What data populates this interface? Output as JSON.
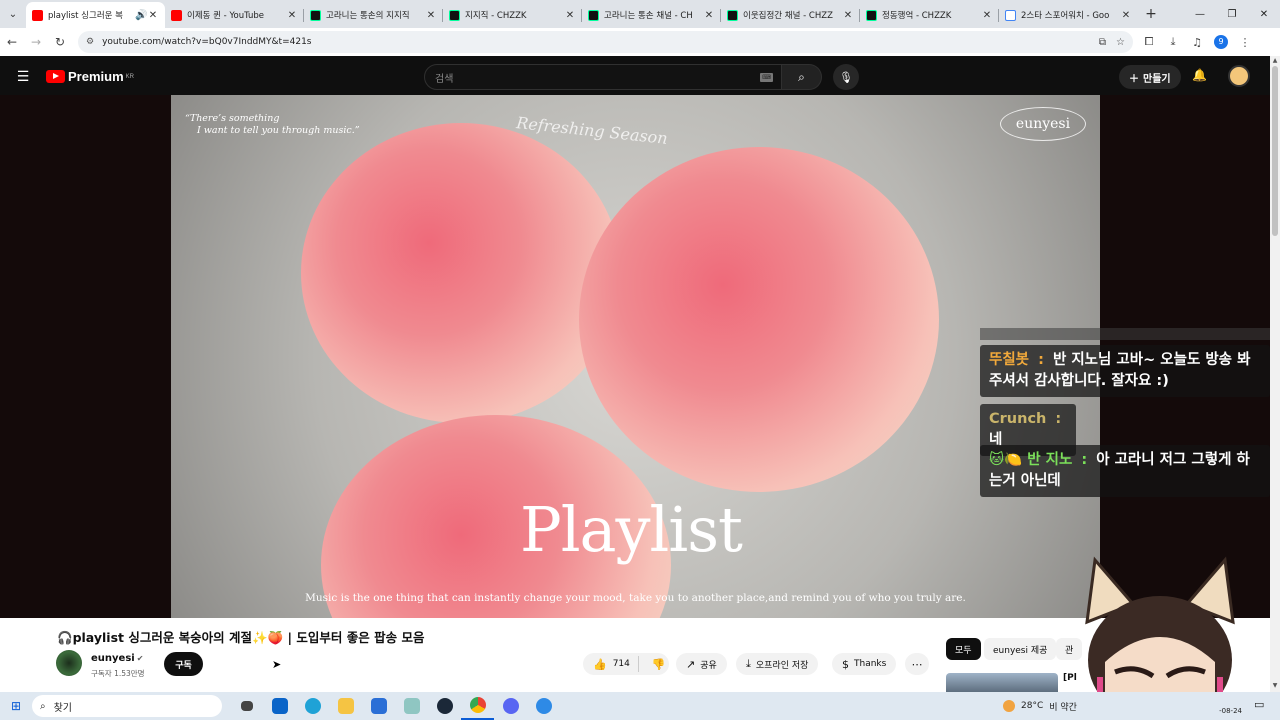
{
  "browser": {
    "tabs": [
      {
        "title": "playlist 싱그러운 복",
        "favicon": "youtube",
        "active": true
      },
      {
        "title": "이제동 퀸 - YouTube",
        "favicon": "youtube"
      },
      {
        "title": "고라니는 통손의 지지직",
        "favicon": "chzzk"
      },
      {
        "title": "지지직 - CHZZK",
        "favicon": "chzzk"
      },
      {
        "title": "고라니는 통손 채널 - CH",
        "favicon": "chzzk"
      },
      {
        "title": "이웃집정간 채널 - CHZZ",
        "favicon": "chzzk"
      },
      {
        "title": "정동행억 - CHZZK",
        "favicon": "chzzk"
      },
      {
        "title": "2스타 스포어워치 - Goo",
        "favicon": "google"
      }
    ],
    "url": "youtube.com/watch?v=bQ0v7InddMY&t=421s",
    "profile_initial": "9"
  },
  "youtube": {
    "logo_text": "Premium",
    "logo_region": "KR",
    "search_placeholder": "검색",
    "create_label": "만들기"
  },
  "video_frame": {
    "quote_line1": "“There’s something",
    "quote_line2": "I want to tell you through music.”",
    "script_text": "Refreshing Season",
    "brand": "eunyesi",
    "title": "Playlist",
    "caption": "Music is the one thing that can instantly change your mood, take you to another place,and remind you of who you truly are."
  },
  "chat": {
    "messages": [
      {
        "nick": "뚜칠봇",
        "sep": " : ",
        "text": "반 지노님 고바~ 오늘도 방송 봐주셔서 감사합니다. 잘자요 :)",
        "nick_color": "#f2a93b"
      },
      {
        "nick": "Crunch",
        "sep": " : ",
        "text": "네",
        "nick_color": "#c9b46a"
      },
      {
        "nick": "🐱🍋 반 지노",
        "sep": " : ",
        "text": "아 고라니 저그 그렇게 하는거 아닌데",
        "nick_color": "#7be05a"
      }
    ]
  },
  "video_info": {
    "title": "🎧playlist 싱그러운 복숭아의 계절✨🍑 | 도입부터 좋은 팝송 모음",
    "channel": "eunyesi",
    "subscribers": "구독자 1.53만명",
    "subscribe_label": "구독",
    "likes": "714",
    "share_label": "공유",
    "download_label": "오프라인 저장",
    "thanks_label": "Thanks"
  },
  "sidebar": {
    "chips": [
      "모두",
      "eunyesi 제공",
      "관"
    ],
    "rec_title_partial": "[Pl"
  },
  "taskbar": {
    "search_label": "찾기",
    "temperature": "28°C",
    "weather": "비 약간",
    "date": "-08-24"
  },
  "colors": {
    "youtube_red": "#ff0000",
    "chat_bg": "rgba(20,20,20,0.72)",
    "tab_strip": "#dfe3e8"
  }
}
